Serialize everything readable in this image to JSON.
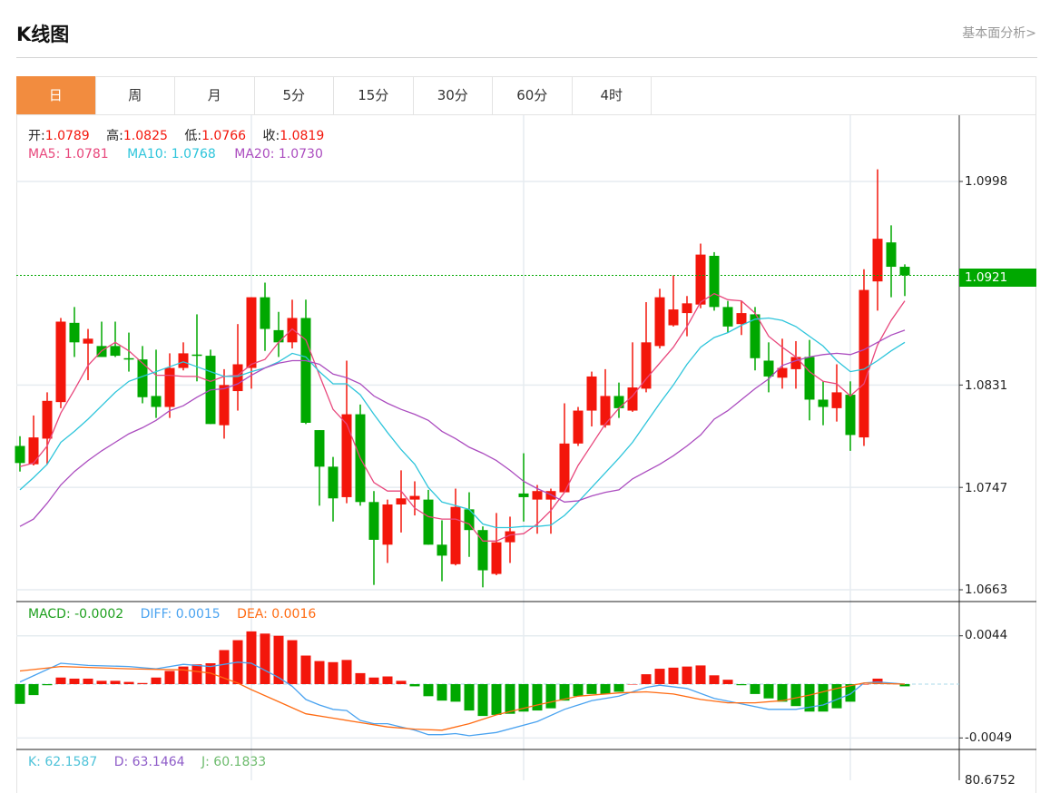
{
  "header": {
    "title": "K线图",
    "link": "基本面分析>"
  },
  "tabs": [
    {
      "label": "日",
      "active": true
    },
    {
      "label": "周"
    },
    {
      "label": "月"
    },
    {
      "label": "5分"
    },
    {
      "label": "15分"
    },
    {
      "label": "30分"
    },
    {
      "label": "60分"
    },
    {
      "label": "4时"
    }
  ],
  "ohlc_legend": {
    "open_label": "开:",
    "open": "1.0789",
    "high_label": "高:",
    "high": "1.0825",
    "low_label": "低:",
    "low": "1.0766",
    "close_label": "收:",
    "close": "1.0819"
  },
  "ma_legend": {
    "ma5": "MA5: 1.0781",
    "ma10": "MA10: 1.0768",
    "ma20": "MA20: 1.0730"
  },
  "macd_legend": {
    "macd": "MACD: -0.0002",
    "diff": "DIFF: 0.0015",
    "dea": "DEA: 0.0016"
  },
  "kdj_legend": {
    "k": "K: 62.1587",
    "d": "D: 63.1464",
    "j": "J: 60.1833"
  },
  "price_axis": [
    "1.0998",
    "1.0831",
    "1.0747",
    "1.0663"
  ],
  "macd_axis": [
    "0.0044",
    "-0.0049"
  ],
  "kdj_axis_partial": "80.6752",
  "current_price": "1.0921",
  "colors": {
    "up": "#f3160b",
    "down": "#00a800",
    "ma5": "#e8477c",
    "ma10": "#2ec5db",
    "ma20": "#ab4cbf",
    "diff": "#4aa3f0",
    "dea": "#ff6b12",
    "accent": "#f28c3f"
  },
  "chart_data": [
    {
      "type": "candlestick",
      "title": "K线图 日",
      "ylim": [
        1.0656,
        1.105
      ],
      "yticks": [
        1.0998,
        1.0831,
        1.0747,
        1.0663
      ],
      "current_price": 1.0921,
      "candles": [
        [
          1.0781,
          1.0789,
          1.076,
          1.0767
        ],
        [
          1.0766,
          1.0806,
          1.0765,
          1.0788
        ],
        [
          1.0787,
          1.0825,
          1.0766,
          1.0818
        ],
        [
          1.0817,
          1.0886,
          1.0812,
          1.0883
        ],
        [
          1.0882,
          1.0895,
          1.0854,
          1.0866
        ],
        [
          1.0865,
          1.0877,
          1.0835,
          1.0869
        ],
        [
          1.0863,
          1.0883,
          1.0854,
          1.0854
        ],
        [
          1.0863,
          1.0883,
          1.0854,
          1.0855
        ],
        [
          1.0853,
          1.0874,
          1.0842,
          1.0852
        ],
        [
          1.0852,
          1.0863,
          1.0816,
          1.0821
        ],
        [
          1.0822,
          1.086,
          1.0804,
          1.0813
        ],
        [
          1.0813,
          1.0857,
          1.0804,
          1.0845
        ],
        [
          1.0845,
          1.0866,
          1.0843,
          1.0857
        ],
        [
          1.0856,
          1.0889,
          1.0834,
          1.0855
        ],
        [
          1.0855,
          1.086,
          1.0799,
          1.0799
        ],
        [
          1.0798,
          1.0844,
          1.0787,
          1.0831
        ],
        [
          1.0826,
          1.0881,
          1.081,
          1.0848
        ],
        [
          1.0845,
          1.0903,
          1.0828,
          1.0903
        ],
        [
          1.0903,
          1.0915,
          1.0859,
          1.0877
        ],
        [
          1.0876,
          1.0891,
          1.0854,
          1.0866
        ],
        [
          1.0866,
          1.0901,
          1.0861,
          1.0886
        ],
        [
          1.0886,
          1.0901,
          1.0799,
          1.08
        ],
        [
          1.0794,
          1.0794,
          1.0732,
          1.0764
        ],
        [
          1.0764,
          1.0772,
          1.0719,
          1.0738
        ],
        [
          1.0739,
          1.0851,
          1.0734,
          1.0807
        ],
        [
          1.0807,
          1.0815,
          1.0732,
          1.0735
        ],
        [
          1.0735,
          1.0744,
          1.0667,
          1.0704
        ],
        [
          1.07,
          1.0737,
          1.0685,
          1.0733
        ],
        [
          1.0733,
          1.0761,
          1.071,
          1.0738
        ],
        [
          1.0737,
          1.0752,
          1.0724,
          1.074
        ],
        [
          1.0737,
          1.0745,
          1.07,
          1.07
        ],
        [
          1.07,
          1.072,
          1.067,
          1.0691
        ],
        [
          1.0684,
          1.0746,
          1.0683,
          1.0731
        ],
        [
          1.0729,
          1.0743,
          1.069,
          1.0712
        ],
        [
          1.0712,
          1.0715,
          1.0665,
          1.0679
        ],
        [
          1.0676,
          1.0726,
          1.0675,
          1.0702
        ],
        [
          1.0702,
          1.0723,
          1.0685,
          1.0711
        ],
        [
          1.0742,
          1.0775,
          1.0719,
          1.0739
        ],
        [
          1.0737,
          1.0749,
          1.0709,
          1.0744
        ],
        [
          1.0737,
          1.0746,
          1.0709,
          1.0744
        ],
        [
          1.0743,
          1.0816,
          1.0743,
          1.0783
        ],
        [
          1.0783,
          1.0813,
          1.0781,
          1.081
        ],
        [
          1.081,
          1.0842,
          1.0797,
          1.0838
        ],
        [
          1.0798,
          1.0844,
          1.0796,
          1.0822
        ],
        [
          1.0822,
          1.0833,
          1.0804,
          1.0812
        ],
        [
          1.081,
          1.0866,
          1.0809,
          1.0829
        ],
        [
          1.0828,
          1.0899,
          1.0825,
          1.0866
        ],
        [
          1.0863,
          1.091,
          1.0861,
          1.0903
        ],
        [
          1.088,
          1.0921,
          1.0879,
          1.0893
        ],
        [
          1.089,
          1.0904,
          1.0871,
          1.0898
        ],
        [
          1.0897,
          1.0947,
          1.0894,
          1.0938
        ],
        [
          1.0937,
          1.094,
          1.0892,
          1.0895
        ],
        [
          1.0895,
          1.09,
          1.0874,
          1.0879
        ],
        [
          1.0881,
          1.09,
          1.0872,
          1.089
        ],
        [
          1.0889,
          1.0895,
          1.0843,
          1.0853
        ],
        [
          1.0851,
          1.0866,
          1.0825,
          1.0838
        ],
        [
          1.0837,
          1.0869,
          1.0828,
          1.0845
        ],
        [
          1.0844,
          1.0867,
          1.0828,
          1.0854
        ],
        [
          1.0854,
          1.0868,
          1.0802,
          1.0819
        ],
        [
          1.0819,
          1.0834,
          1.0798,
          1.0813
        ],
        [
          1.0812,
          1.0848,
          1.0801,
          1.0825
        ],
        [
          1.0823,
          1.0834,
          1.0777,
          1.079
        ],
        [
          1.0788,
          1.0926,
          1.0781,
          1.0909
        ],
        [
          1.0916,
          1.1008,
          1.0892,
          1.0951
        ],
        [
          1.0948,
          1.0962,
          1.0903,
          1.0928
        ],
        [
          1.0928,
          1.093,
          1.0904,
          1.0921
        ]
      ],
      "ma5": [
        1.0764,
        1.0767,
        1.0781,
        1.0808,
        1.0827,
        1.0847,
        1.0859,
        1.0866,
        1.0859,
        1.0849,
        1.0839,
        1.0839,
        1.0838,
        1.0838,
        1.0834,
        1.0838,
        1.0839,
        1.0848,
        1.0852,
        1.0866,
        1.0877,
        1.0868,
        1.0839,
        1.0811,
        1.0799,
        1.0771,
        1.0751,
        1.0744,
        1.0744,
        1.073,
        1.0723,
        1.0721,
        1.0721,
        1.0717,
        1.0703,
        1.0703,
        1.0708,
        1.0709,
        1.0717,
        1.0728,
        1.0743,
        1.0765,
        1.0782,
        1.0799,
        1.0812,
        1.0822,
        1.0836,
        1.0849,
        1.0862,
        1.0879,
        1.0899,
        1.0906,
        1.0901,
        1.09,
        1.089,
        1.0871,
        1.0862,
        1.0854,
        1.0842,
        1.0834,
        1.0832,
        1.0822,
        1.0832,
        1.0864,
        1.0884,
        1.09
      ],
      "ma10": [
        1.0745,
        1.0755,
        1.0766,
        1.0784,
        1.0793,
        1.0803,
        1.0814,
        1.0825,
        1.0834,
        1.0838,
        1.0842,
        1.0846,
        1.085,
        1.0846,
        1.0842,
        1.0838,
        1.0838,
        1.0842,
        1.0845,
        1.085,
        1.0857,
        1.0854,
        1.0842,
        1.0832,
        1.0832,
        1.0823,
        1.0807,
        1.0792,
        1.0778,
        1.0766,
        1.0747,
        1.0735,
        1.0732,
        1.0729,
        1.0717,
        1.0714,
        1.0714,
        1.0715,
        1.0715,
        1.0716,
        1.0724,
        1.0735,
        1.0747,
        1.0759,
        1.0771,
        1.0784,
        1.08,
        1.0816,
        1.0831,
        1.0848,
        1.0862,
        1.087,
        1.0874,
        1.088,
        1.0885,
        1.0886,
        1.0884,
        1.0879,
        1.0871,
        1.0863,
        1.0851,
        1.0842,
        1.0844,
        1.0851,
        1.0859,
        1.0866
      ],
      "ma20": [
        1.0715,
        1.0721,
        1.0734,
        1.0749,
        1.076,
        1.0769,
        1.0777,
        1.0784,
        1.0791,
        1.0796,
        1.0802,
        1.081,
        1.0814,
        1.0821,
        1.0827,
        1.0828,
        1.0832,
        1.0839,
        1.0845,
        1.0849,
        1.0851,
        1.0851,
        1.0848,
        1.084,
        1.0837,
        1.0832,
        1.0822,
        1.0816,
        1.0811,
        1.0807,
        1.0802,
        1.0793,
        1.0787,
        1.078,
        1.0775,
        1.0769,
        1.0761,
        1.0752,
        1.0746,
        1.0741,
        1.0735,
        1.0736,
        1.074,
        1.0743,
        1.0745,
        1.0754,
        1.076,
        1.0766,
        1.0773,
        1.0781,
        1.079,
        1.0803,
        1.081,
        1.0819,
        1.0828,
        1.0836,
        1.0847,
        1.0851,
        1.0854,
        1.0856,
        1.0857,
        1.0856,
        1.086,
        1.0866,
        1.0872,
        1.0876
      ]
    },
    {
      "type": "bar+line",
      "title": "MACD",
      "yticks": [
        0.0044,
        -0.0049
      ],
      "macd": [
        -0.0018,
        -0.001,
        -0.0001,
        0.0006,
        0.0005,
        0.0005,
        0.0003,
        0.0003,
        0.0002,
        0.0001,
        0.0006,
        0.0012,
        0.0016,
        0.0018,
        0.0019,
        0.0031,
        0.004,
        0.0048,
        0.0046,
        0.0044,
        0.004,
        0.0026,
        0.0021,
        0.002,
        0.0022,
        0.001,
        0.0006,
        0.0007,
        0.0003,
        -0.0002,
        -0.0011,
        -0.0015,
        -0.0016,
        -0.0024,
        -0.0029,
        -0.0028,
        -0.0027,
        -0.0025,
        -0.0024,
        -0.0022,
        -0.0015,
        -0.0011,
        -0.0009,
        -0.0009,
        -0.0007,
        0.0,
        0.0009,
        0.0014,
        0.0015,
        0.0016,
        0.0017,
        0.0008,
        0.0004,
        -0.0001,
        -0.0009,
        -0.0013,
        -0.0016,
        -0.002,
        -0.0025,
        -0.0025,
        -0.0022,
        -0.0016,
        0.0,
        0.0005,
        0.0001,
        -0.0002
      ],
      "diff": [
        [
          0,
          0.0002
        ],
        [
          3,
          0.0019
        ],
        [
          5,
          0.0017
        ],
        [
          8,
          0.0016
        ],
        [
          10,
          0.0014
        ],
        [
          12,
          0.0018
        ],
        [
          14,
          0.0016
        ],
        [
          16,
          0.002
        ],
        [
          17,
          0.0019
        ],
        [
          19,
          0.0006
        ],
        [
          20,
          -0.0002
        ],
        [
          21,
          -0.0014
        ],
        [
          22,
          -0.0019
        ],
        [
          23,
          -0.0023
        ],
        [
          24,
          -0.0024
        ],
        [
          25,
          -0.0033
        ],
        [
          26,
          -0.0036
        ],
        [
          27,
          -0.0036
        ],
        [
          28,
          -0.0039
        ],
        [
          29,
          -0.0042
        ],
        [
          30,
          -0.0046
        ],
        [
          31,
          -0.0046
        ],
        [
          32,
          -0.0045
        ],
        [
          33,
          -0.0047
        ],
        [
          35,
          -0.0044
        ],
        [
          38,
          -0.0034
        ],
        [
          40,
          -0.0023
        ],
        [
          42,
          -0.0015
        ],
        [
          44,
          -0.0011
        ],
        [
          46,
          -0.0003
        ],
        [
          47,
          -0.0001
        ],
        [
          49,
          -0.0004
        ],
        [
          51,
          -0.0013
        ],
        [
          53,
          -0.0018
        ],
        [
          55,
          -0.0023
        ],
        [
          57,
          -0.0023
        ],
        [
          59,
          -0.0019
        ],
        [
          61,
          -0.0009
        ],
        [
          62,
          0.0001
        ],
        [
          63,
          0.0002
        ],
        [
          65,
          0.0
        ]
      ],
      "dea": [
        [
          0,
          0.0012
        ],
        [
          3,
          0.0016
        ],
        [
          8,
          0.0014
        ],
        [
          12,
          0.0013
        ],
        [
          14,
          0.001
        ],
        [
          16,
          0.0001
        ],
        [
          17,
          -0.0005
        ],
        [
          19,
          -0.0016
        ],
        [
          21,
          -0.0027
        ],
        [
          23,
          -0.0031
        ],
        [
          25,
          -0.0035
        ],
        [
          27,
          -0.0039
        ],
        [
          29,
          -0.0041
        ],
        [
          31,
          -0.0042
        ],
        [
          33,
          -0.0036
        ],
        [
          35,
          -0.0028
        ],
        [
          38,
          -0.0019
        ],
        [
          41,
          -0.0011
        ],
        [
          44,
          -0.0008
        ],
        [
          46,
          -0.0007
        ],
        [
          48,
          -0.0009
        ],
        [
          50,
          -0.0014
        ],
        [
          52,
          -0.0017
        ],
        [
          54,
          -0.0017
        ],
        [
          56,
          -0.0015
        ],
        [
          58,
          -0.001
        ],
        [
          60,
          -0.0004
        ],
        [
          62,
          0.0001
        ],
        [
          65,
          0.0
        ]
      ]
    }
  ]
}
